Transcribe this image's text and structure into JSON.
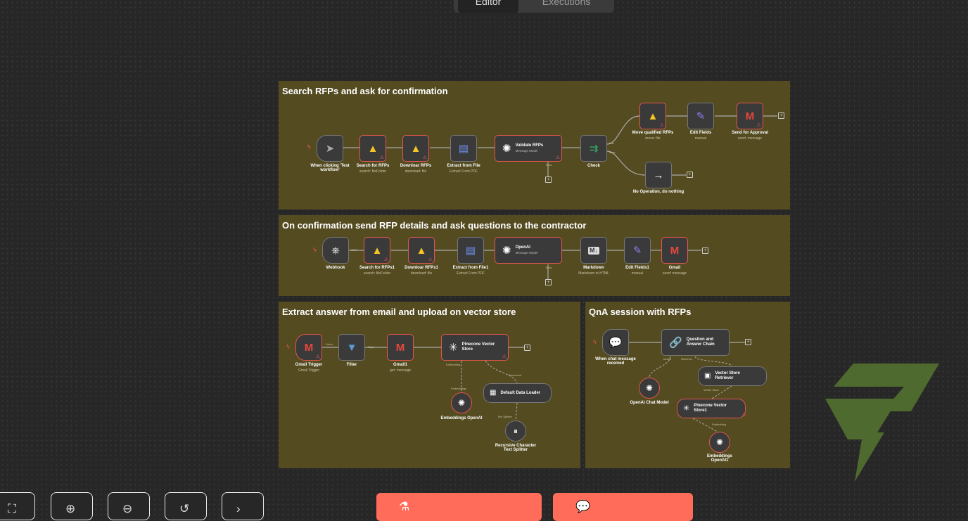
{
  "tabs": {
    "editor": "Editor",
    "executions": "Executions"
  },
  "groups": [
    {
      "title": "Search RFPs and ask for confirmation"
    },
    {
      "title": "On confirmation send RFP details and ask questions to the contractor"
    },
    {
      "title": "Extract answer from email and upload on vector store"
    },
    {
      "title": "QnA session with RFPs"
    }
  ],
  "g1": {
    "trigger": {
      "name": "When clicking 'Test workflow'",
      "icon": "cursor-icon"
    },
    "search": {
      "name": "Search for RFPs",
      "sub": "search: fileFolder"
    },
    "download": {
      "name": "Downloar RFPs",
      "sub": "download: file"
    },
    "extract": {
      "name": "Extract from File",
      "sub": "Extract From PDF"
    },
    "validate": {
      "name": "Validate RFPs",
      "sub": "Message Model"
    },
    "check": {
      "name": "Check"
    },
    "move": {
      "name": "Move qualified RFPs",
      "sub": "move: file"
    },
    "edit": {
      "name": "Edit Fields",
      "sub": "manual"
    },
    "send": {
      "name": "Send for Approval",
      "sub": "send: message"
    },
    "noop": {
      "name": "No Operation, do nothing"
    },
    "true_label": "true",
    "false_label": "false",
    "tool_label": "Tools"
  },
  "g2": {
    "webhook": {
      "name": "Webhook"
    },
    "search": {
      "name": "Search for RFPs1",
      "sub": "search: fileFolder"
    },
    "download": {
      "name": "Downloar RFPs1",
      "sub": "download: file"
    },
    "extract": {
      "name": "Extract from File1",
      "sub": "Extract From PDF"
    },
    "openai": {
      "name": "OpenAI",
      "sub": "Message Model"
    },
    "markdown": {
      "name": "Markdown",
      "sub": "Markdown to HTML"
    },
    "edit": {
      "name": "Edit Fields1",
      "sub": "manual"
    },
    "gmail": {
      "name": "Gmail",
      "sub": "send: message"
    },
    "get_label": "GET",
    "tool_label": "Tools"
  },
  "g3": {
    "trigger": {
      "name": "Gmail Trigger",
      "sub": "Gmail Trigger"
    },
    "filter": {
      "name": "Filter"
    },
    "gmail": {
      "name": "Gmail1",
      "sub": "get: message"
    },
    "pinecone": {
      "name": "Pinecone Vector Store"
    },
    "embeddings": {
      "name": "Embeddings OpenAI"
    },
    "loader": {
      "name": "Default Data Loader"
    },
    "splitter": {
      "name": "Recursive Character Text Splitter"
    },
    "item_label": "1 item",
    "kept_label": "Kept",
    "emb_label": "Embedding",
    "doc_label": "Document",
    "emb_port": "Embeddings",
    "splitter_port": "Text Splitter"
  },
  "g4": {
    "chat": {
      "name": "When chat message received"
    },
    "qa": {
      "name": "Question and Answer Chain"
    },
    "model": {
      "name": "OpenAi Chat Model"
    },
    "retriever": {
      "name": "Vector Store Retriever"
    },
    "pinecone": {
      "name": "Pinecone Vector Store1"
    },
    "embeddings": {
      "name": "Embeddings OpenAI1"
    },
    "model_port": "Model",
    "retriever_port": "Retriever",
    "vs_port": "Vector Store",
    "emb_port": "Embedding"
  },
  "controls": [
    "fit-view",
    "zoom-in",
    "zoom-out",
    "reset-zoom",
    "tidy-up"
  ],
  "actions": {
    "test": "Test workflow",
    "chat": "Chat"
  },
  "colors": {
    "canvas": "#272727",
    "sticky": "#544b21",
    "error": "#e2574c",
    "accent": "#ff6d5a"
  }
}
